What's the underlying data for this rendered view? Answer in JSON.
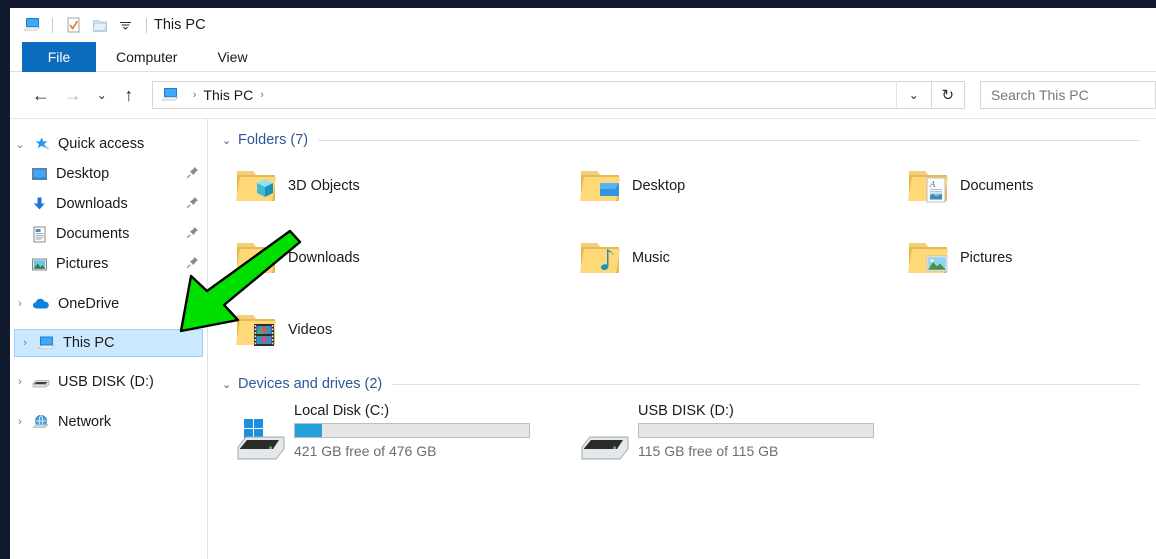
{
  "window": {
    "title": "This PC",
    "quick_access_toolbar": [
      {
        "name": "this-pc-icon",
        "label": "This PC"
      },
      {
        "name": "properties-icon",
        "label": "Properties"
      },
      {
        "name": "new-folder-icon",
        "label": "New folder"
      },
      {
        "name": "customize-chevron-icon",
        "label": "Customize Quick Access Toolbar"
      }
    ]
  },
  "ribbon": {
    "tabs": [
      {
        "label": "File",
        "active": true
      },
      {
        "label": "Computer",
        "active": false
      },
      {
        "label": "View",
        "active": false
      }
    ]
  },
  "navbar": {
    "back": "←",
    "forward": "→",
    "recent": "⌄",
    "up": "↑",
    "breadcrumb": [
      "This PC"
    ],
    "breadcrumb_separator": "›",
    "address_dropdown": "⌄",
    "refresh": "↻"
  },
  "search": {
    "placeholder": "Search This PC",
    "value": ""
  },
  "sidebar": {
    "items": [
      {
        "label": "Quick access",
        "icon": "star-pin-icon",
        "chevron": "⌄",
        "expanded": true,
        "child": false,
        "pinned": false,
        "selected": false
      },
      {
        "label": "Desktop",
        "icon": "desktop-icon",
        "chevron": "",
        "expanded": false,
        "child": true,
        "pinned": true,
        "selected": false
      },
      {
        "label": "Downloads",
        "icon": "downloads-icon",
        "chevron": "",
        "expanded": false,
        "child": true,
        "pinned": true,
        "selected": false
      },
      {
        "label": "Documents",
        "icon": "documents-icon",
        "chevron": "",
        "expanded": false,
        "child": true,
        "pinned": true,
        "selected": false
      },
      {
        "label": "Pictures",
        "icon": "pictures-icon",
        "chevron": "",
        "expanded": false,
        "child": true,
        "pinned": true,
        "selected": false
      },
      {
        "label": "OneDrive",
        "icon": "onedrive-cloud-icon",
        "chevron": "›",
        "expanded": false,
        "child": false,
        "pinned": false,
        "selected": false
      },
      {
        "label": "This PC",
        "icon": "this-pc-icon",
        "chevron": "›",
        "expanded": false,
        "child": false,
        "pinned": false,
        "selected": true
      },
      {
        "label": "USB DISK (D:)",
        "icon": "usb-drive-icon",
        "chevron": "›",
        "expanded": false,
        "child": false,
        "pinned": false,
        "selected": false
      },
      {
        "label": "Network",
        "icon": "network-icon",
        "chevron": "›",
        "expanded": false,
        "child": false,
        "pinned": false,
        "selected": false
      }
    ],
    "pin_glyph": "📌"
  },
  "content": {
    "folders_group": {
      "title": "Folders (7)",
      "chevron": "⌄",
      "items": [
        {
          "label": "3D Objects",
          "icon": "folder-3d-objects-icon"
        },
        {
          "label": "Desktop",
          "icon": "folder-desktop-icon"
        },
        {
          "label": "Documents",
          "icon": "folder-documents-icon"
        },
        {
          "label": "Downloads",
          "icon": "folder-downloads-icon"
        },
        {
          "label": "Music",
          "icon": "folder-music-icon"
        },
        {
          "label": "Pictures",
          "icon": "folder-pictures-icon"
        },
        {
          "label": "Videos",
          "icon": "folder-videos-icon"
        }
      ]
    },
    "drives_group": {
      "title": "Devices and drives (2)",
      "chevron": "⌄",
      "items": [
        {
          "label": "Local Disk (C:)",
          "icon": "windows-hard-drive-icon",
          "free_text": "421 GB free of 476 GB",
          "used_percent": 11.5,
          "bar_color": "#26a0da"
        },
        {
          "label": "USB DISK (D:)",
          "icon": "usb-drive-icon",
          "free_text": "115 GB free of 115 GB",
          "used_percent": 0,
          "bar_color": "#26a0da"
        }
      ]
    }
  },
  "annotation": {
    "arrow": {
      "name": "green-annotation-arrow",
      "color": "#00e000",
      "outline": "#000000",
      "direction": "down-left"
    }
  },
  "colors": {
    "accent": "#0b6cbd",
    "selection": "#cce8ff",
    "group_header": "#2b5797",
    "frame": "#0f1a2e"
  }
}
